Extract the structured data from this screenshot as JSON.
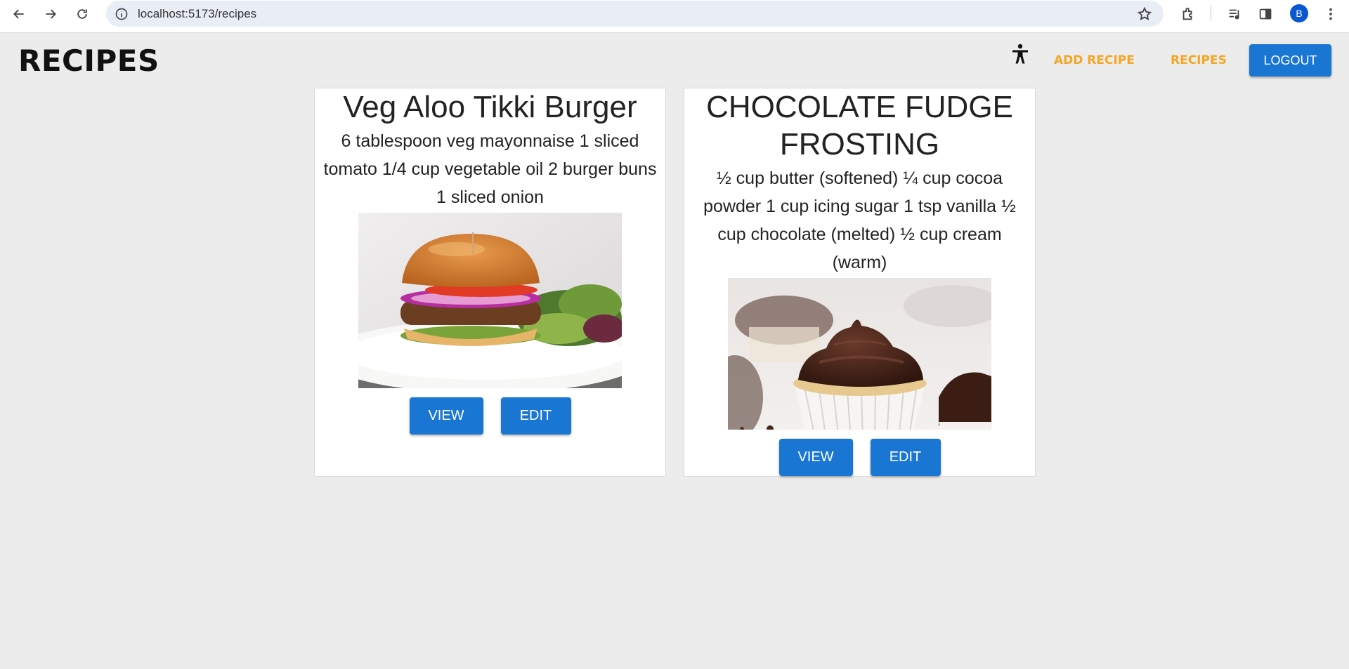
{
  "browser": {
    "url": "localhost:5173/recipes",
    "profile_initial": "B"
  },
  "app": {
    "title": "RECIPES",
    "nav": {
      "add_recipe": "ADD RECIPE",
      "recipes": "RECIPES",
      "logout": "LOGOUT"
    }
  },
  "recipes": [
    {
      "title": "Veg Aloo Tikki Burger",
      "ingredients": "6 tablespoon veg mayonnaise 1 sliced tomato 1/4 cup vegetable oil 2 burger buns 1 sliced onion",
      "view_label": "VIEW",
      "edit_label": "EDIT"
    },
    {
      "title": "CHOCOLATE FUDGE FROSTING",
      "ingredients": "½ cup butter (softened) ¼ cup cocoa powder 1 cup icing sugar 1 tsp vanilla ½ cup chocolate (melted) ½ cup cream (warm)",
      "view_label": "VIEW",
      "edit_label": "EDIT"
    }
  ],
  "colors": {
    "primary": "#1976d2",
    "nav_link": "#f5a623",
    "background": "#ececec"
  }
}
